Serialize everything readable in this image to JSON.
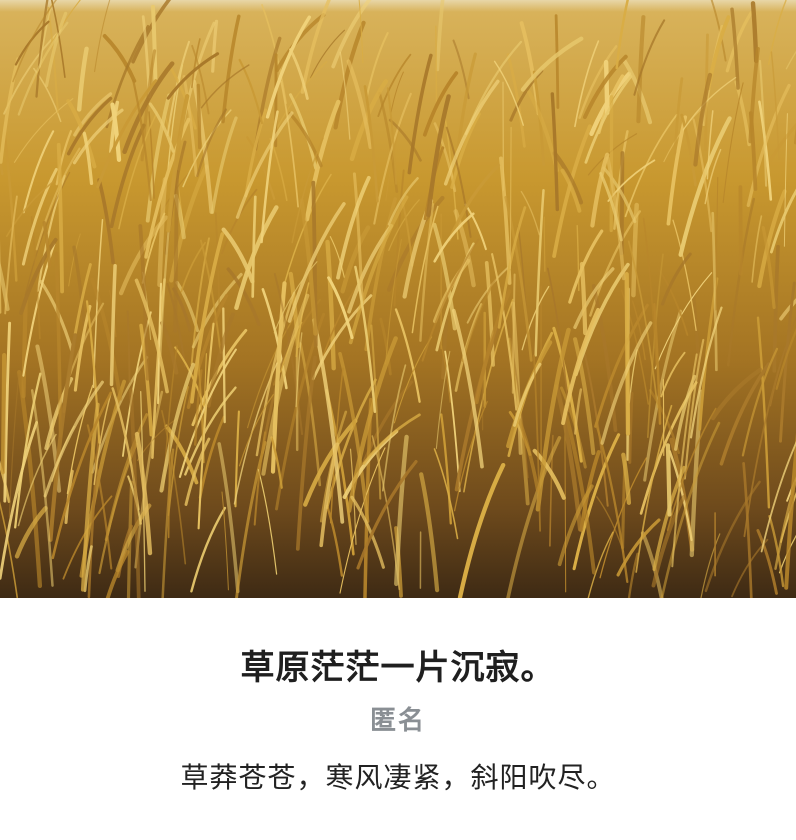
{
  "photo": {
    "subject_icon": "rice-field-photo",
    "colors": {
      "sky_strip": "#e8d6a8",
      "grain_light": "#e6c060",
      "grain_mid": "#c99a36",
      "grain_dark": "#7a5420",
      "soil": "#3e2a14"
    }
  },
  "quote": {
    "text": "草原茫茫一片沉寂。",
    "author": "匿名",
    "body": "草莽苍苍，寒风凄紧，斜阳吹尽。"
  }
}
